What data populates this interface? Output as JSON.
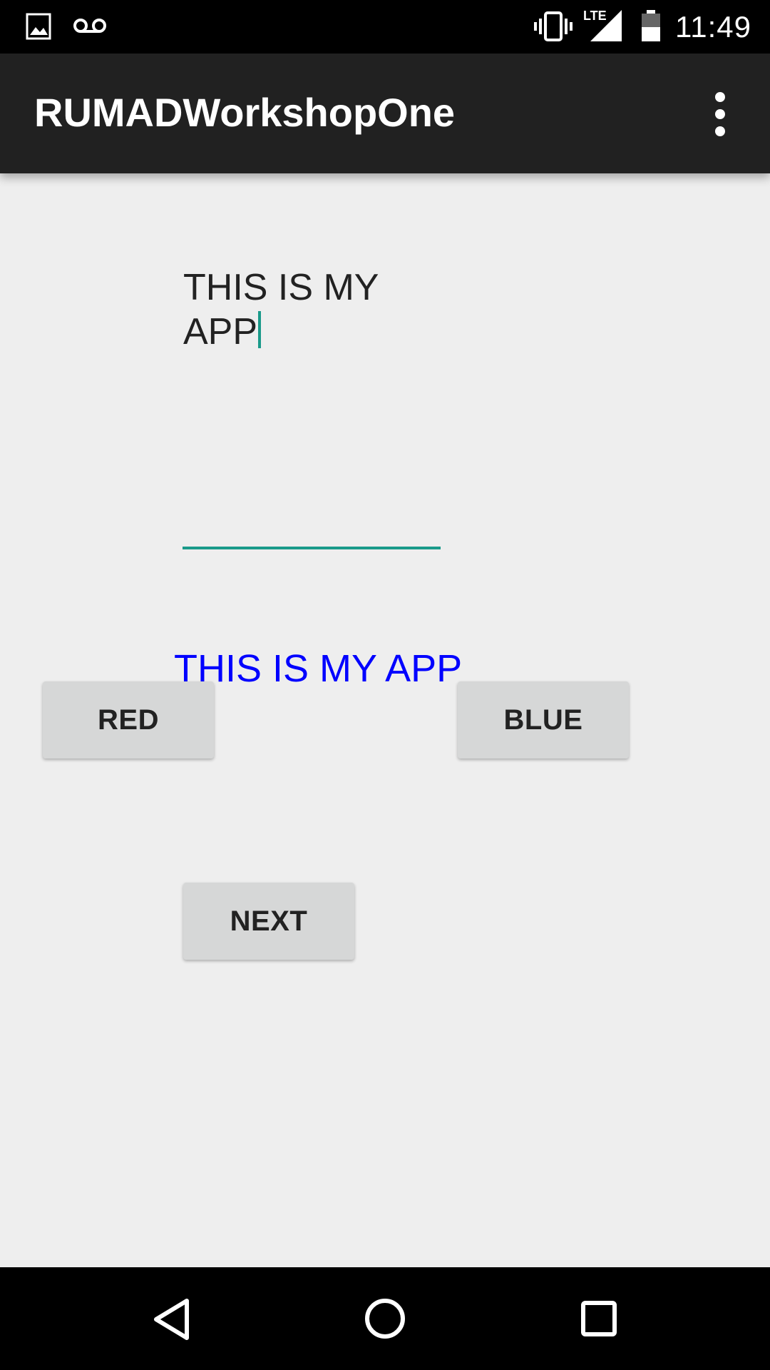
{
  "status_bar": {
    "time": "11:49",
    "network_label": "LTE",
    "icons": [
      "image-notification-icon",
      "voicemail-icon",
      "vibrate-icon",
      "lte-signal-icon",
      "battery-icon"
    ]
  },
  "app_bar": {
    "title": "RUMADWorkshopOne",
    "background": "#212121"
  },
  "edit_text": {
    "value": "THIS IS MY APP",
    "accent": "#1a9a8a"
  },
  "display_text": {
    "value": "THIS IS MY APP",
    "color": "#0000ff"
  },
  "buttons": {
    "red_label": "RED",
    "blue_label": "BLUE",
    "next_label": "NEXT"
  },
  "nav_bar": {
    "icons": [
      "back-icon",
      "home-icon",
      "recents-icon"
    ]
  }
}
